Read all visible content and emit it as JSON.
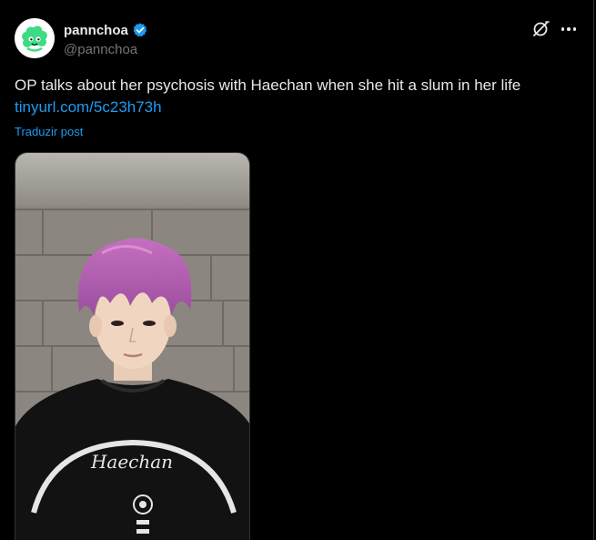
{
  "author": {
    "display_name": "pannchoa",
    "handle": "@pannchoa",
    "verified": true,
    "avatar_icon": "pannchoa-logo-icon",
    "avatar_color": "#3ddc84"
  },
  "actions": {
    "grok_icon": "grok-icon",
    "more_icon": "more-horizontal-icon"
  },
  "post": {
    "text": "OP talks about her psychosis with Haechan when she hit a slum in her life",
    "link": "tinyurl.com/5c23h73h",
    "translate_label": "Traduzir post"
  },
  "media": {
    "kind": "photo",
    "shirt_text": "Haechan"
  },
  "colors": {
    "background": "#000000",
    "text": "#e7e9ea",
    "secondary": "#71767b",
    "accent": "#1d9bf0",
    "border": "#2f3336"
  }
}
